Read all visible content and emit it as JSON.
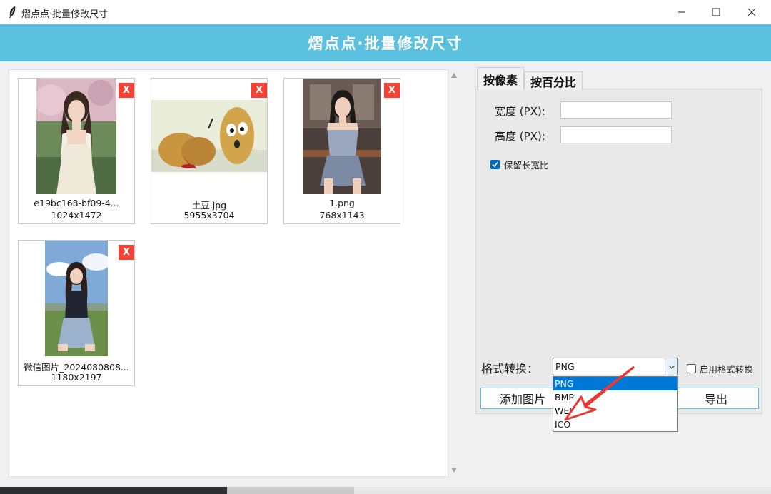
{
  "window": {
    "title": "熠点点·批量修改尺寸",
    "app_icon": "feather-icon",
    "controls": [
      "minimize-icon",
      "maximize-icon",
      "close-icon"
    ]
  },
  "header": {
    "title": "熠点点·批量修改尺寸",
    "background": "#5bc0de"
  },
  "gallery": {
    "delete_label": "X",
    "items": [
      {
        "name": "e19bc168-bf09-4...",
        "size": "1024x1472"
      },
      {
        "name": "土豆.jpg",
        "size": "5955x3704"
      },
      {
        "name": "1.png",
        "size": "768x1143"
      },
      {
        "name": "微信图片_2024080808...",
        "size": "1180x2197"
      }
    ]
  },
  "tabs": {
    "pixel": "按像素",
    "percent": "按百分比"
  },
  "pixel_form": {
    "width_label": "宽度 (PX):",
    "height_label": "高度 (PX):",
    "width_value": "",
    "height_value": "",
    "keep_ratio_label": "保留长宽比",
    "keep_ratio_checked": true
  },
  "format": {
    "label": "格式转换：",
    "selected": "PNG",
    "options": [
      "PNG",
      "BMP",
      "WEBP",
      "ICO"
    ],
    "enable_label": "启用格式转换",
    "enable_checked": false
  },
  "buttons": {
    "add": "添加图片",
    "export": "导出"
  },
  "colors": {
    "accent": "#5bc0de",
    "delete": "#f44336",
    "selection": "#0078d7",
    "annotation": "#e53935"
  }
}
